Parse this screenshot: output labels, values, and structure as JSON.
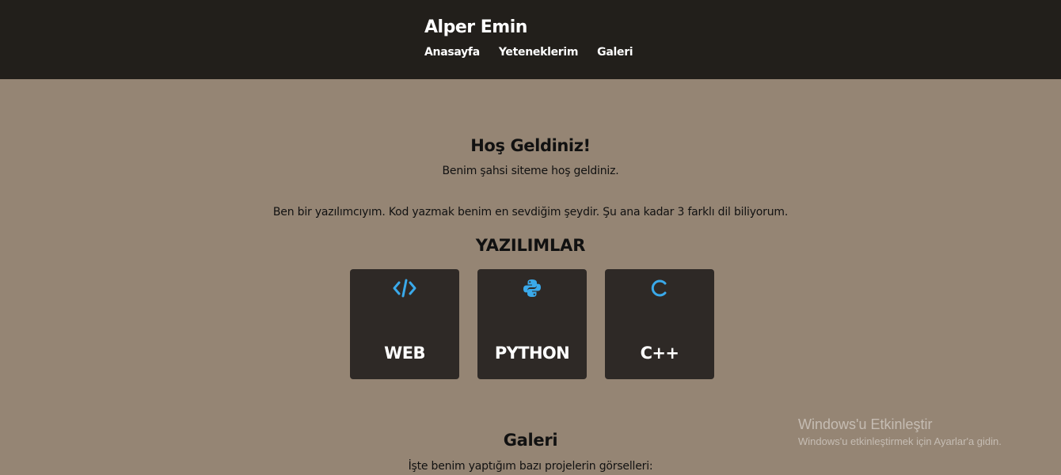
{
  "header": {
    "brand": "Alper Emin",
    "nav": [
      "Anasayfa",
      "Yeteneklerim",
      "Galeri"
    ]
  },
  "welcome": {
    "title": "Hoş Geldiniz!",
    "subtitle": "Benim şahsi siteme hoş geldiniz.",
    "intro": "Ben bir yazılımcıyım. Kod yazmak benim en sevdiğim şeydir. Şu ana kadar 3 farklı dil biliyorum."
  },
  "software": {
    "title": "YAZILIMLAR",
    "cards": [
      {
        "label": "WEB",
        "icon": "code-icon"
      },
      {
        "label": "PYTHON",
        "icon": "python-icon"
      },
      {
        "label": "C++",
        "icon": "c-letter-icon"
      }
    ]
  },
  "gallery": {
    "title": "Galeri",
    "subtitle": "İşte benim yaptığım bazı projelerin görselleri:"
  },
  "watermark": {
    "line1": "Windows'u Etkinleştir",
    "line2": "Windows'u etkinleştirmek için Ayarlar'a gidin."
  },
  "colors": {
    "header_bg": "#221f1b",
    "page_bg": "#958574",
    "card_bg": "#2e2926",
    "icon_accent": "#3aa9ea"
  }
}
